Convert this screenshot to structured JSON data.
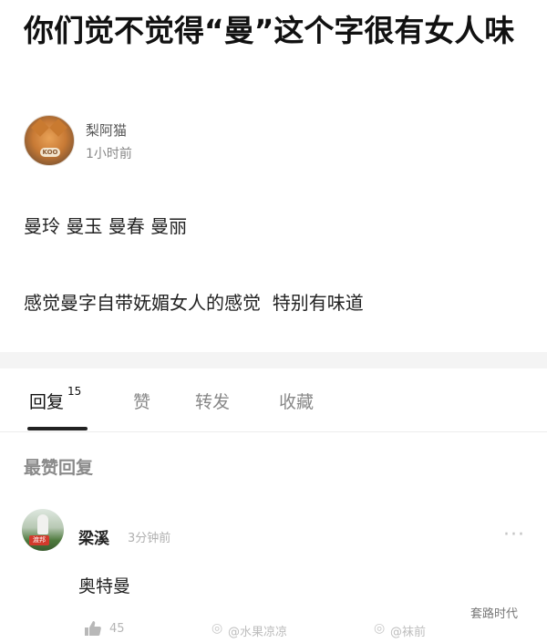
{
  "post": {
    "title": "你们觉不觉得“曼”这个字很有女人味",
    "author": "梨阿猫",
    "time": "1小时前",
    "avatar_badge": "KOO",
    "body_lines": [
      "曼玲 曼玉 曼春 曼丽",
      "感觉曼字自带妩媚女人的感觉  特别有味道"
    ]
  },
  "tabs": [
    {
      "label": "回复",
      "count": "15",
      "active": true
    },
    {
      "label": "赞"
    },
    {
      "label": "转发"
    },
    {
      "label": "收藏"
    }
  ],
  "section_header": "最赞回复",
  "comment": {
    "avatar_tag": "渡邦",
    "name": "梁溪",
    "time": "3分钟前",
    "more_icon": "more-dots-icon",
    "text": "奥特曼",
    "like_icon": "thumbs-up-icon",
    "likes": "45"
  },
  "watermarks": [
    "@水果凉凉",
    "@袜前",
    "套路时代"
  ],
  "colors": {
    "accent": "#222222",
    "muted": "#888888",
    "divider": "#f4f4f4"
  }
}
